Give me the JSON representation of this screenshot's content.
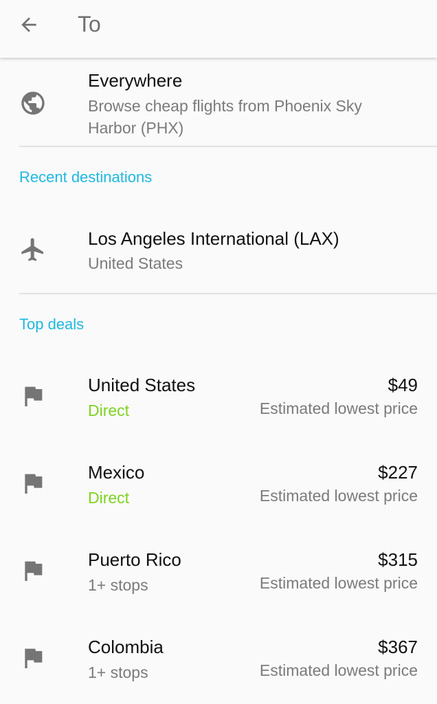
{
  "header": {
    "title": "To",
    "back_icon": "arrow-back-icon"
  },
  "everywhere": {
    "icon": "globe-icon",
    "title": "Everywhere",
    "subtitle_line1": "Browse cheap flights from Phoenix Sky",
    "subtitle_line2": "Harbor (PHX)"
  },
  "recent": {
    "heading": "Recent destinations",
    "items": [
      {
        "icon": "airplane-icon",
        "title": "Los Angeles International (LAX)",
        "subtitle": "United States"
      }
    ]
  },
  "deals": {
    "heading": "Top deals",
    "items": [
      {
        "icon": "flag-icon",
        "country": "United States",
        "stops": "Direct",
        "price": "$49",
        "price_note": "Estimated lowest price"
      },
      {
        "icon": "flag-icon",
        "country": "Mexico",
        "stops": "Direct",
        "price": "$227",
        "price_note": "Estimated lowest price"
      },
      {
        "icon": "flag-icon",
        "country": "Puerto Rico",
        "stops": "1+ stops",
        "price": "$315",
        "price_note": "Estimated lowest price"
      },
      {
        "icon": "flag-icon",
        "country": "Colombia",
        "stops": "1+ stops",
        "price": "$367",
        "price_note": "Estimated lowest price"
      }
    ]
  },
  "colors": {
    "accent": "#1fb8e0",
    "direct": "#7ed321",
    "icon": "#757575"
  }
}
